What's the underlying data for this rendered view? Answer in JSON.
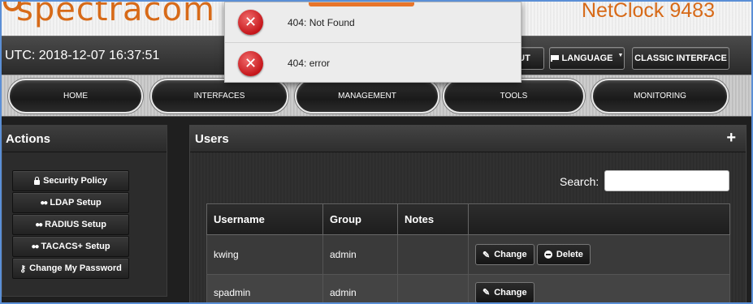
{
  "brand": {
    "logo_text": "spectracom",
    "product": "NetClock 9483"
  },
  "top_bar": {
    "utc": "UTC: 2018-12-07 16:37:51",
    "logout_label": "UT",
    "language_label": "LANGUAGE",
    "classic_label": "CLASSIC INTERFACE"
  },
  "nav": {
    "items": [
      "HOME",
      "INTERFACES",
      "MANAGEMENT",
      "TOOLS",
      "MONITORING"
    ]
  },
  "actions": {
    "title": "Actions",
    "items": [
      {
        "label": "Security Policy",
        "icon": "lock-icon"
      },
      {
        "label": "LDAP Setup",
        "icon": "users-icon"
      },
      {
        "label": "RADIUS Setup",
        "icon": "users-icon"
      },
      {
        "label": "TACACS+ Setup",
        "icon": "users-icon"
      },
      {
        "label": "Change My Password",
        "icon": "key-icon"
      }
    ]
  },
  "users": {
    "title": "Users",
    "search_label": "Search:",
    "search_value": "",
    "columns": [
      "Username",
      "Group",
      "Notes",
      ""
    ],
    "rows": [
      {
        "username": "kwing",
        "group": "admin",
        "notes": "",
        "change_label": "Change",
        "delete_label": "Delete"
      },
      {
        "username": "spadmin",
        "group": "admin",
        "notes": "",
        "change_label": "Change"
      }
    ]
  },
  "notifications": [
    {
      "type": "error",
      "message": "404: Not Found"
    },
    {
      "type": "error",
      "message": "404: error"
    }
  ],
  "colors": {
    "brand_orange": "#d76a18",
    "error_red": "#c5161b",
    "frame_border": "#5b8fd6"
  }
}
